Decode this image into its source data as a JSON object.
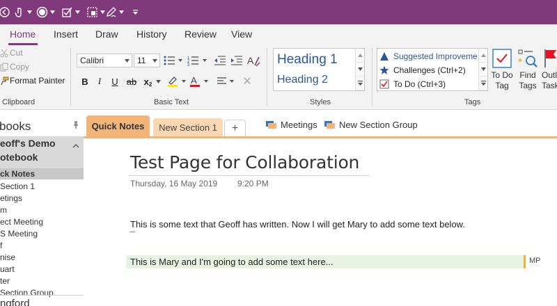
{
  "colors": {
    "brand": "#80397b",
    "ribbon_bg": "#f3f3f3",
    "section_active": "#f2b579",
    "section_inactive": "#fcd8b2",
    "heading": "#2b579a",
    "author_highlight": "#e6f4e1",
    "author_bar": "#f0b13a"
  },
  "qat": {
    "items": [
      "back-icon",
      "touch-mode-icon",
      "record-icon",
      "checkbox-tag-icon",
      "screen-clip-icon",
      "draw-pen-icon",
      "customize-icon"
    ]
  },
  "tabs": [
    "Home",
    "Insert",
    "Draw",
    "History",
    "Review",
    "View"
  ],
  "ribbon": {
    "clipboard": {
      "cut": "Cut",
      "copy": "Copy",
      "format_painter": "Format Painter",
      "label": "Clipboard"
    },
    "basic_text": {
      "font": "Calibri",
      "size": "11",
      "label": "Basic Text",
      "bold": "B",
      "italic": "I",
      "underline": "U",
      "strike": "ab",
      "subscript": "x",
      "subscript_mark": "2",
      "clear": "✕"
    },
    "styles": {
      "heading1": "Heading 1",
      "heading2": "Heading 2",
      "label": "Styles"
    },
    "tags": {
      "items": [
        "Suggested Improveme",
        "Challenges (Ctrl+2)",
        "To Do (Ctrl+3)"
      ],
      "todo_tag": [
        "To Do",
        "Tag"
      ],
      "find_tags": [
        "Find",
        "Tags"
      ],
      "outlook_tasks": [
        "Outl",
        "Task"
      ],
      "label": "Tags"
    }
  },
  "nav": {
    "header": "books",
    "notebook_lines": [
      "eoff's Demo",
      "otebook"
    ],
    "sections": [
      "ck Notes",
      "Section 1",
      "etings",
      "m",
      "ect Meeting",
      "S Meeting",
      "f",
      "nise",
      "uart",
      "ter",
      "Section Group"
    ],
    "next_notebook": "ngford"
  },
  "section_tabs": {
    "active": "Quick Notes",
    "other": "New Section 1",
    "add": "+",
    "groups": [
      "Meetings",
      "New Section Group"
    ]
  },
  "page": {
    "title": "Test Page for Collaboration",
    "date": "Thursday, 16 May 2019",
    "time": "9:20 PM",
    "paragraph1": "This is some text that Geoff has written. Now I will get Mary to add some text below.",
    "paragraph2": "This is Mary and I'm going to add some text here...",
    "author_initials": "MP"
  }
}
